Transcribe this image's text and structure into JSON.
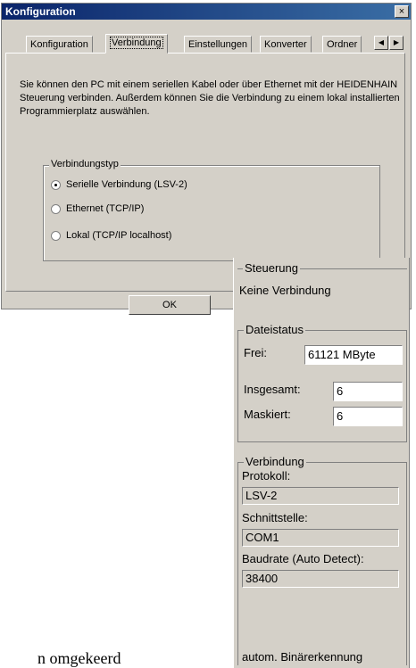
{
  "dialog": {
    "title": "Konfiguration",
    "close": "×",
    "tabs": [
      "Konfiguration",
      "Verbindung",
      "Einstellungen",
      "Konverter",
      "Ordner"
    ],
    "active_tab": 1,
    "scroll_left": "◀",
    "scroll_right": "▶",
    "description": "Sie können den PC mit einem seriellen Kabel oder über Ethernet mit der HEIDENHAIN Steuerung verbinden. Außerdem können Sie die Verbindung zu einem lokal installierten Programmierplatz auswählen.",
    "group_title": "Verbindungstyp",
    "radios": [
      {
        "label": "Serielle Verbindung (LSV-2)",
        "selected": true
      },
      {
        "label": "Ethernet (TCP/IP)",
        "selected": false
      },
      {
        "label": "Lokal (TCP/IP localhost)",
        "selected": false
      }
    ],
    "ok_label": "OK"
  },
  "status_panel": {
    "steuerung_title": "Steuerung",
    "steuerung_value": "Keine Verbindung",
    "dateistatus_title": "Dateistatus",
    "frei_label": "Frei:",
    "frei_value": "61121 MByte",
    "insgesamt_label": "Insgesamt:",
    "insgesamt_value": "6",
    "maskiert_label": "Maskiert:",
    "maskiert_value": "6",
    "verbindung_title": "Verbindung",
    "protokoll_label": "Protokoll:",
    "protokoll_value": "LSV-2",
    "schnittstelle_label": "Schnittstelle:",
    "schnittstelle_value": "COM1",
    "baudrate_label": "Baudrate (Auto Detect):",
    "baudrate_value": "38400",
    "binaer_label": "autom. Binärerkennung"
  },
  "page_text": "n omgekeerd"
}
